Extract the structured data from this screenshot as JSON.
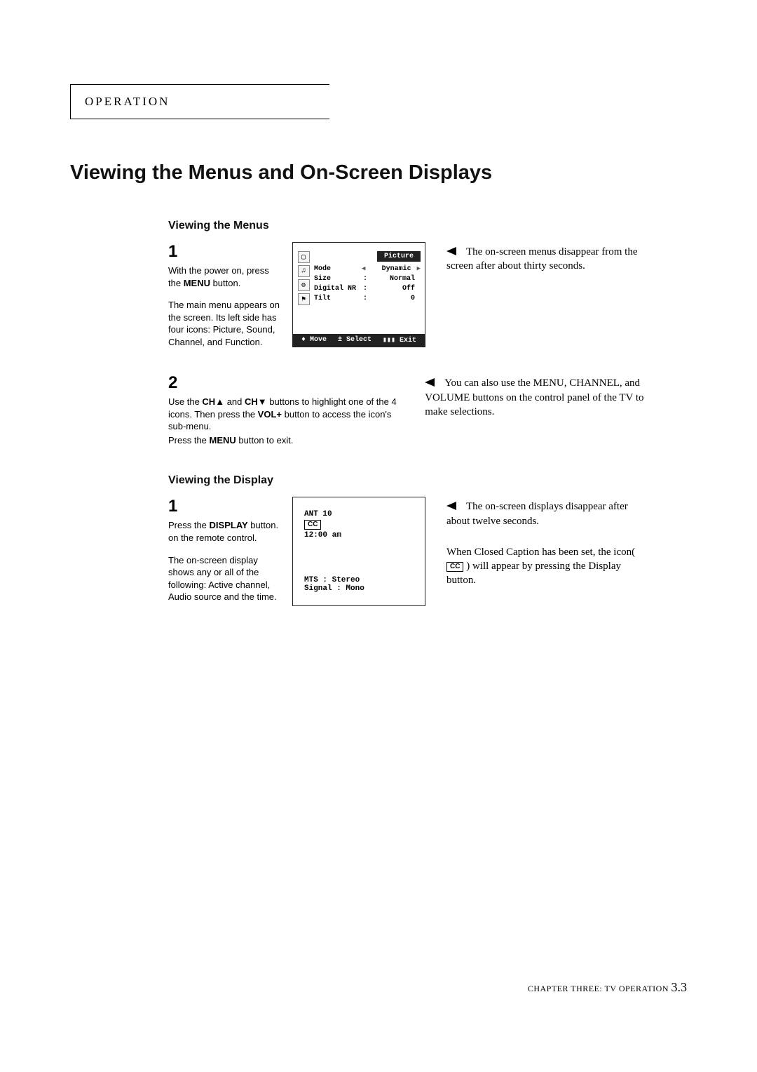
{
  "header": {
    "tab": "OPERATION"
  },
  "title": "Viewing the Menus and On-Screen Displays",
  "section1": {
    "heading": "Viewing the Menus",
    "step1_num": "1",
    "step1_a": "With the power on, press the ",
    "step1_bold": "MENU",
    "step1_b": " button.",
    "step1_p2": "The main menu appears on the screen. Its left side has four icons: Picture, Sound, Channel, and Function.",
    "step2_num": "2",
    "step2_a": "Use the ",
    "step2_chup": "CH▲",
    "step2_b": " and ",
    "step2_chdn": "CH▼",
    "step2_c": " buttons to highlight one of the 4 icons. Then press the ",
    "step2_vol": "VOL+",
    "step2_d": " button to access the icon's sub-menu.",
    "step2_p2a": "Press the ",
    "step2_p2bold": "MENU",
    "step2_p2b": " button to exit.",
    "note1": "The on-screen menus disappear from the screen after about thirty seconds.",
    "note2": "You can also use the MENU, CHANNEL, and VOLUME buttons on the control panel of the TV to make selections."
  },
  "tv_menu": {
    "title": "Picture",
    "rows": [
      {
        "k": "Mode",
        "sep": "◀",
        "v": "Dynamic",
        "tail": "▶"
      },
      {
        "k": "Size",
        "sep": ":",
        "v": "Normal",
        "tail": ""
      },
      {
        "k": "Digital NR",
        "sep": ":",
        "v": "Off",
        "tail": ""
      },
      {
        "k": "Tilt",
        "sep": ":",
        "v": "0",
        "tail": ""
      }
    ],
    "footer": {
      "move": "♦ Move",
      "select": "± Select",
      "exit": "▮▮▮ Exit"
    },
    "icons": [
      "▢",
      "♫",
      "⚙",
      "⚑"
    ]
  },
  "section2": {
    "heading": "Viewing the Display",
    "step1_num": "1",
    "step1_a": "Press the ",
    "step1_bold": "DISPLAY",
    "step1_b": " button. on the remote control.",
    "step1_p2": "The on-screen display shows any or all of the following: Active channel, Audio source and the time.",
    "note1": "The on-screen displays disappear after about twelve seconds.",
    "note2_a": "When Closed Caption has been set, the icon( ",
    "note2_cc": "CC",
    "note2_b": " ) will appear by pressing the Display button."
  },
  "display_box": {
    "line1": "ANT  10",
    "cc": "CC",
    "time": "12:00 am",
    "mts": "MTS    :  Stereo",
    "signal": "Signal :  Mono"
  },
  "footer": {
    "chapter_a": "CHAPTER THREE: TV OPERATION ",
    "page": "3.3"
  }
}
